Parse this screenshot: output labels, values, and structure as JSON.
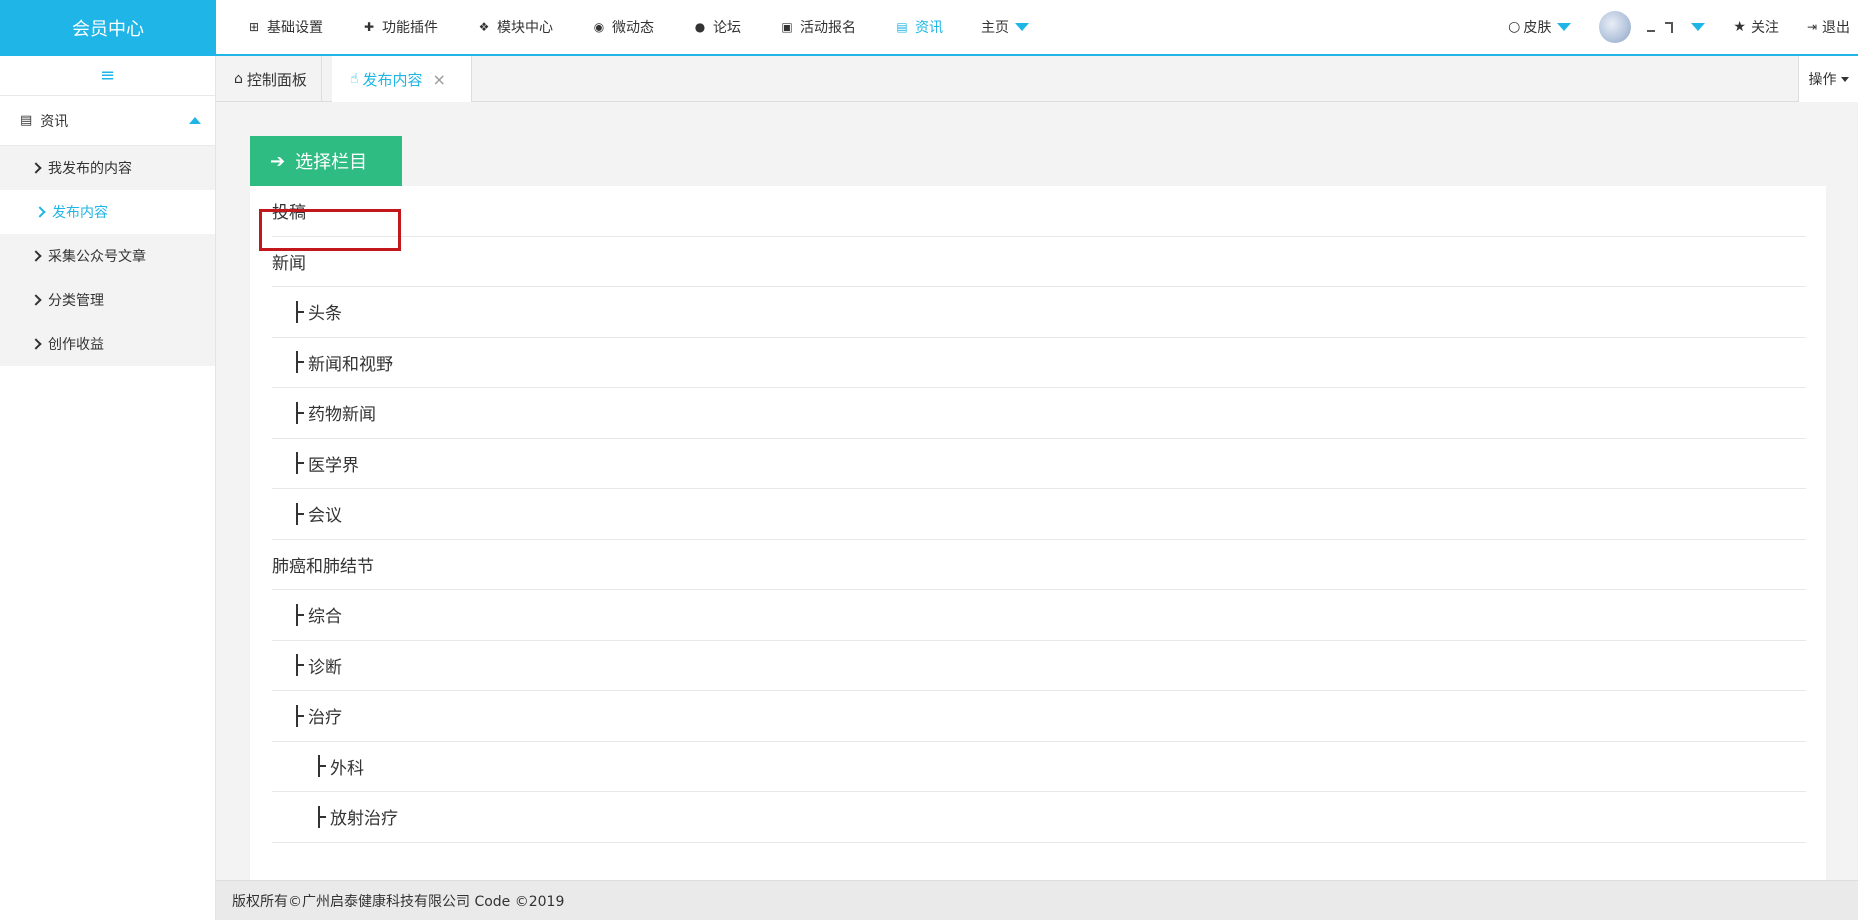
{
  "brand": "会员中心",
  "topnav": {
    "items": [
      {
        "label": "基础设置",
        "icon": "windows-icon",
        "glyph": "⊞"
      },
      {
        "label": "功能插件",
        "icon": "puzzle-icon",
        "glyph": "✚"
      },
      {
        "label": "模块中心",
        "icon": "cubes-icon",
        "glyph": "❖"
      },
      {
        "label": "微动态",
        "icon": "weibo-icon",
        "glyph": "◉"
      },
      {
        "label": "论坛",
        "icon": "comment-icon",
        "glyph": "●"
      },
      {
        "label": "活动报名",
        "icon": "linkedin-icon",
        "glyph": "▣"
      },
      {
        "label": "资讯",
        "icon": "file-icon",
        "glyph": "▤"
      },
      {
        "label": "主页",
        "icon": "",
        "glyph": ""
      }
    ]
  },
  "topright": {
    "skin_label": "皮肤",
    "follow_label": "关注",
    "logout_label": "退出"
  },
  "sidebar": {
    "group_label": "资讯",
    "items": [
      {
        "label": "我发布的内容"
      },
      {
        "label": "发布内容"
      },
      {
        "label": "采集公众号文章"
      },
      {
        "label": "分类管理"
      },
      {
        "label": "创作收益"
      }
    ]
  },
  "tabs": {
    "dashboard": "控制面板",
    "publish": "发布内容",
    "close_glyph": "×",
    "ops_label": "操作"
  },
  "content": {
    "select_button": "选择栏目",
    "categories": [
      {
        "label": "投稿",
        "level": 0
      },
      {
        "label": "新闻",
        "level": 0
      },
      {
        "label": "头条",
        "level": 1
      },
      {
        "label": "新闻和视野",
        "level": 1
      },
      {
        "label": "药物新闻",
        "level": 1
      },
      {
        "label": "医学界",
        "level": 1
      },
      {
        "label": "会议",
        "level": 1
      },
      {
        "label": "肺癌和肺结节",
        "level": 0
      },
      {
        "label": "综合",
        "level": 1
      },
      {
        "label": "诊断",
        "level": 1
      },
      {
        "label": "治疗",
        "level": 1
      },
      {
        "label": "外科",
        "level": 2
      },
      {
        "label": "放射治疗",
        "level": 2
      }
    ]
  },
  "footer": "版权所有©广州启泰健康科技有限公司 Code ©2019",
  "colors": {
    "accent": "#1fb5e6",
    "button_green": "#2fbc82",
    "highlight_red": "#c4171d"
  }
}
